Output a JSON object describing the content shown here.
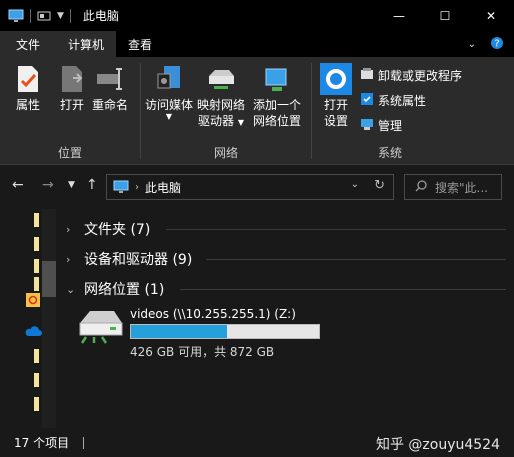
{
  "window": {
    "title": "此电脑",
    "controls": {
      "minimize": "—",
      "maximize": "☐",
      "close": "✕"
    }
  },
  "ribbon": {
    "tabs": [
      {
        "label": "文件"
      },
      {
        "label": "计算机"
      },
      {
        "label": "查看"
      }
    ],
    "groups": {
      "location": {
        "label": "位置",
        "buttons": {
          "properties": "属性",
          "open": "打开",
          "rename": "重命名"
        }
      },
      "network": {
        "label": "网络",
        "buttons": {
          "access_media": "访问媒体",
          "map_drive_1": "映射网络",
          "map_drive_2": "驱动器",
          "add_location_1": "添加一个",
          "add_location_2": "网络位置"
        }
      },
      "system": {
        "label": "系统",
        "open_settings_1": "打开",
        "open_settings_2": "设置",
        "uninstall": "卸载或更改程序",
        "system_properties": "系统属性",
        "manage": "管理"
      }
    }
  },
  "address": {
    "path": "此电脑"
  },
  "search": {
    "placeholder": "搜索\"此..."
  },
  "sections": [
    {
      "label": "文件夹 (7)"
    },
    {
      "label": "设备和驱动器 (9)"
    },
    {
      "label": "网络位置 (1)"
    }
  ],
  "drive": {
    "name": "videos (\\\\10.255.255.1) (Z:)",
    "space": "426 GB 可用，共 872 GB",
    "used_fraction": 0.51
  },
  "status": {
    "count": "17 个项目"
  },
  "watermark": "知乎 @zouyu4524",
  "colors": {
    "accent": "#26a0da",
    "background": "#191919",
    "ribbon": "#2b2b2b"
  }
}
